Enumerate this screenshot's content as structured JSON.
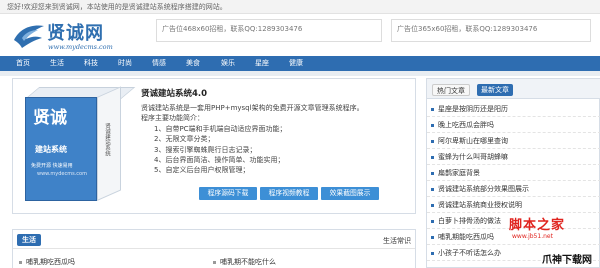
{
  "topbar": {
    "welcome": "您好!欢迎您来到贤诚网，本站使用的是贤诚建站系统程序搭建的网站。"
  },
  "logo": {
    "name": "贤诚网",
    "url": "www.mydecms.com"
  },
  "ads": [
    {
      "text": "广告位468x60招租，联系QQ:1289303476"
    },
    {
      "text": "广告位365x60招租，联系QQ:1289303476"
    }
  ],
  "nav": [
    "首页",
    "生活",
    "科技",
    "时尚",
    "情感",
    "美食",
    "娱乐",
    "星座",
    "健康"
  ],
  "feature": {
    "title": "贤诚建站系统4.0",
    "lines": [
      "贤诚建站系统是一套用PHP+mysql架构的免费开源文章管理系统程序。",
      "程序主要功能简介：",
      "1、自带PC端和手机端自动适应界面功能；",
      "2、无限文章分类；",
      "3、搜索引擎蜘蛛爬行日志记录；",
      "4、后台界面简洁、操作简单、功能实用；",
      "5、自定义后台用户权限管理；"
    ],
    "buttons": [
      "程序源码下载",
      "程序视频教程",
      "效果截图展示"
    ],
    "box": {
      "brand": "贤诚",
      "sub": "建站系统",
      "tag": "免费开源  快速易用",
      "url": "www.mydecms.com",
      "side": "贤诚建站系统"
    }
  },
  "right": {
    "tabs": [
      "热门文章",
      "最新文章"
    ],
    "items": [
      "星座是按阴历还是阳历",
      "晚上吃西瓜会胖吗",
      "阿尔卑斯山在哪里查询",
      "蜜蜂为什么叫哥胡蜂嘛",
      "扁鹊家庭背景",
      "贤诚建站系统部分效果图展示",
      "贤诚建站系统商业授权说明",
      "白萝卜排骨汤的做法",
      "哺乳期能吃西瓜吗",
      "小孩子不听话怎么办"
    ]
  },
  "lower": {
    "tag": "生活",
    "category": "生活常识",
    "items": [
      "哺乳期吃西瓜吗",
      "哺乳期不能吃什么"
    ]
  },
  "watermark": {
    "main": "脚本之家",
    "url": "www.jb51.net",
    "corner": "爪神下载网"
  }
}
